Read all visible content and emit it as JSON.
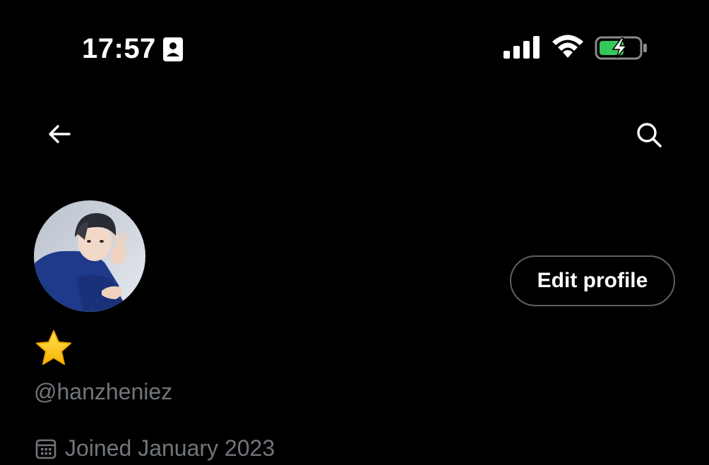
{
  "status_bar": {
    "time": "17:57",
    "battery_color": "#34c759"
  },
  "nav": {
    "back_icon": "arrow-left-icon",
    "search_icon": "search-icon"
  },
  "profile": {
    "name_emoji": "⭐",
    "handle": "@hanzheniez",
    "joined": "Joined January 2023",
    "edit_profile_label": "Edit profile"
  },
  "colors": {
    "background": "#000000",
    "secondary_text": "#71767b",
    "button_border": "#5c6166"
  }
}
